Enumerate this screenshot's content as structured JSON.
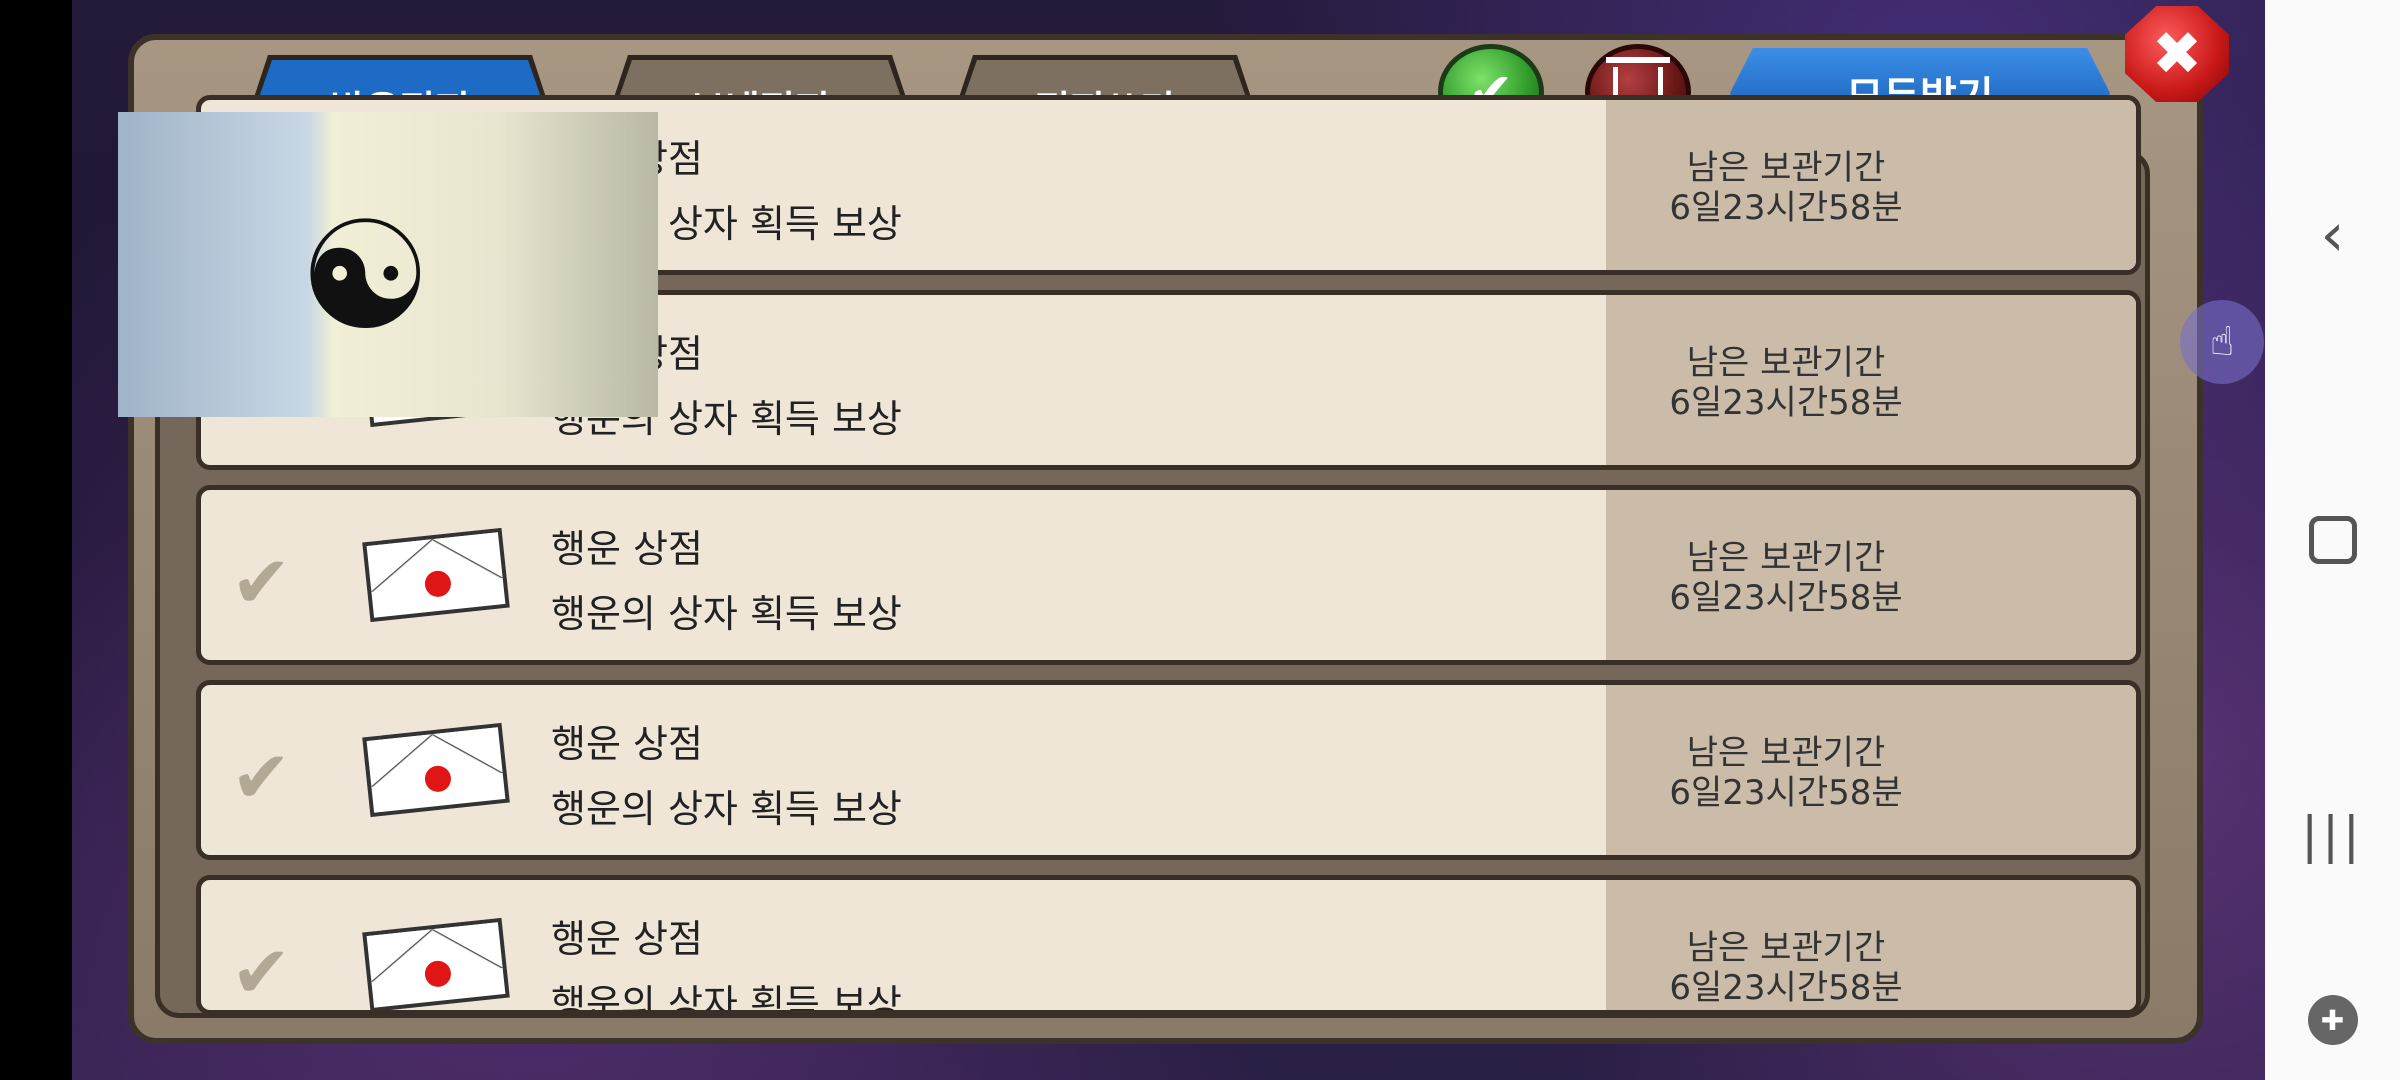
{
  "tabs": {
    "inbox": "받은편지",
    "sent": "보낸편지",
    "write": "편지쓰기"
  },
  "toolbar": {
    "receive_all": "모두받기",
    "check_icon": "✔",
    "close_icon": "✖"
  },
  "mails": [
    {
      "title": "행운 상점",
      "desc": "행운의 상자 획득 보상",
      "remain_label": "남은 보관기간",
      "remain_value": "6일23시간58분",
      "item": "blue-crystal-icon"
    },
    {
      "title": "행운 상점",
      "desc": "행운의 상자 획득 보상",
      "remain_label": "남은 보관기간",
      "remain_value": "6일23시간58분",
      "item": "purple-emblem-icon"
    },
    {
      "title": "행운 상점",
      "desc": "행운의 상자 획득 보상",
      "remain_label": "남은 보관기간",
      "remain_value": "6일23시간58분",
      "item": "potion-icon"
    },
    {
      "title": "행운 상점",
      "desc": "행운의 상자 획득 보상",
      "remain_label": "남은 보관기간",
      "remain_value": "6일23시간58분",
      "item": "potion-icon"
    },
    {
      "title": "행운 상점",
      "desc": "행운의 상자 획득 보상",
      "remain_label": "남은 보관기간",
      "remain_value": "6일23시간58분",
      "item": "golden-crest-icon"
    }
  ],
  "nav": {
    "back": "‹",
    "recent": "|||",
    "game": "✚"
  }
}
